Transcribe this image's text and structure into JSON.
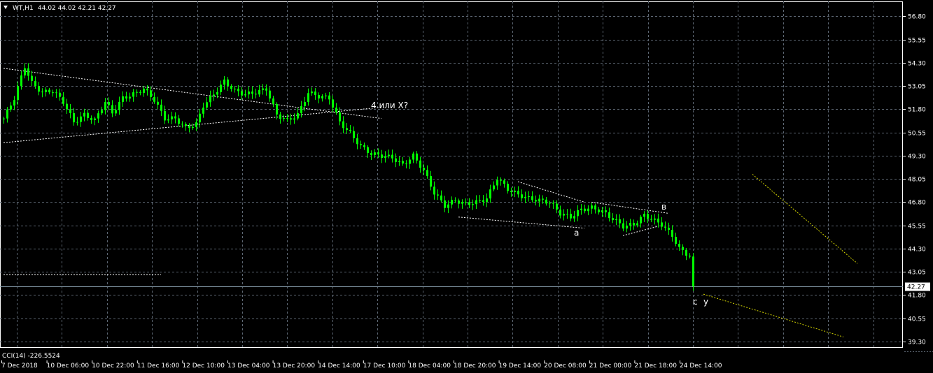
{
  "header": {
    "symbol": "WT,H1",
    "ohlc": "44.02 44.02 42.21 42.27",
    "arrow_icon": "triangle-down-icon"
  },
  "indicator": {
    "label": "CCI(14) -226.5524"
  },
  "colors": {
    "background": "#000000",
    "grid": "#5c6672",
    "candle": "#00ff00",
    "trendline": "#ffffff",
    "forecast": "#d6d600",
    "price_line": "#8aa0b0"
  },
  "chart_data": {
    "type": "candlestick",
    "ylim": [
      39.0,
      57.6
    ],
    "y_ticks": [
      "56.80",
      "55.55",
      "54.30",
      "53.05",
      "51.80",
      "50.55",
      "49.30",
      "48.05",
      "46.80",
      "45.55",
      "44.30",
      "43.05",
      "41.80",
      "40.55",
      "39.30"
    ],
    "y_tick_values": [
      56.8,
      55.55,
      54.3,
      53.05,
      51.8,
      50.55,
      49.3,
      48.05,
      46.8,
      45.55,
      44.3,
      43.05,
      41.8,
      40.55,
      39.3
    ],
    "x_ticks": [
      "7 Dec 2018",
      "10 Dec 06:00",
      "10 Dec 22:00",
      "11 Dec 16:00",
      "12 Dec 10:00",
      "13 Dec 04:00",
      "13 Dec 20:00",
      "14 Dec 14:00",
      "17 Dec 10:00",
      "18 Dec 04:00",
      "18 Dec 20:00",
      "19 Dec 14:00",
      "20 Dec 08:00",
      "21 Dec 00:00",
      "21 Dec 18:00",
      "24 Dec 14:00"
    ],
    "current_price": "42.27",
    "current_price_value": 42.27,
    "close_path": [
      [
        0,
        51.3
      ],
      [
        3,
        52.4
      ],
      [
        6,
        54.1
      ],
      [
        8,
        53.2
      ],
      [
        11,
        52.7
      ],
      [
        14,
        52.8
      ],
      [
        17,
        52.2
      ],
      [
        20,
        51.1
      ],
      [
        23,
        51.5
      ],
      [
        26,
        51.2
      ],
      [
        29,
        52.2
      ],
      [
        31,
        51.6
      ],
      [
        34,
        52.4
      ],
      [
        37,
        52.6
      ],
      [
        40,
        52.9
      ],
      [
        43,
        52.3
      ],
      [
        46,
        51.3
      ],
      [
        49,
        51.3
      ],
      [
        52,
        50.8
      ],
      [
        55,
        51.0
      ],
      [
        57,
        52.0
      ],
      [
        60,
        52.6
      ],
      [
        63,
        53.3
      ],
      [
        66,
        52.8
      ],
      [
        69,
        52.6
      ],
      [
        72,
        52.7
      ],
      [
        75,
        52.9
      ],
      [
        78,
        51.5
      ],
      [
        81,
        51.2
      ],
      [
        84,
        51.5
      ],
      [
        87,
        52.7
      ],
      [
        90,
        52.5
      ],
      [
        93,
        52.4
      ],
      [
        96,
        51.1
      ],
      [
        99,
        50.5
      ],
      [
        102,
        49.8
      ],
      [
        105,
        49.4
      ],
      [
        108,
        49.3
      ],
      [
        111,
        49.2
      ],
      [
        114,
        48.8
      ],
      [
        117,
        49.3
      ],
      [
        120,
        48.5
      ],
      [
        123,
        47.3
      ],
      [
        126,
        46.6
      ],
      [
        129,
        46.9
      ],
      [
        132,
        46.7
      ],
      [
        135,
        46.8
      ],
      [
        138,
        47.0
      ],
      [
        141,
        48.1
      ],
      [
        144,
        47.5
      ],
      [
        147,
        47.2
      ],
      [
        150,
        47.0
      ],
      [
        153,
        46.9
      ],
      [
        156,
        46.8
      ],
      [
        159,
        46.2
      ],
      [
        162,
        46.0
      ],
      [
        165,
        46.4
      ],
      [
        168,
        46.5
      ],
      [
        171,
        46.3
      ],
      [
        174,
        45.9
      ],
      [
        177,
        45.5
      ],
      [
        180,
        45.6
      ],
      [
        183,
        46.1
      ],
      [
        185,
        45.9
      ],
      [
        188,
        45.6
      ],
      [
        191,
        45.0
      ],
      [
        193,
        44.3
      ],
      [
        196,
        43.9
      ],
      [
        197,
        42.27
      ]
    ],
    "trendlines": [
      {
        "kind": "upper",
        "from": [
          0,
          54.0
        ],
        "to": [
          108,
          51.3
        ]
      },
      {
        "kind": "lower",
        "from": [
          0,
          50.0
        ],
        "to": [
          108,
          51.9
        ]
      },
      {
        "kind": "upper",
        "from": [
          147,
          47.9
        ],
        "to": [
          166,
          46.8
        ]
      },
      {
        "kind": "lower",
        "from": [
          130,
          46.0
        ],
        "to": [
          166,
          45.4
        ]
      },
      {
        "kind": "upper",
        "from": [
          168,
          46.8
        ],
        "to": [
          190,
          46.2
        ]
      },
      {
        "kind": "lower",
        "from": [
          177,
          45.0
        ],
        "to": [
          187,
          45.5
        ]
      },
      {
        "kind": "horizontal",
        "from": [
          0,
          42.9
        ],
        "to": [
          45,
          42.9
        ]
      }
    ],
    "forecast_lines": [
      {
        "from": [
          200,
          41.85
        ],
        "to": [
          240,
          39.55
        ]
      },
      {
        "from": [
          214,
          48.3
        ],
        "to": [
          244,
          43.5
        ]
      }
    ],
    "labels": [
      {
        "text": "4 или X?",
        "at": [
          105,
          51.85
        ]
      },
      {
        "text": "а",
        "at": [
          163,
          45.0
        ]
      },
      {
        "text": "в",
        "at": [
          188,
          46.4
        ]
      },
      {
        "text": "с",
        "at": [
          197,
          41.3
        ]
      },
      {
        "text": "y",
        "at": [
          200,
          41.3
        ]
      }
    ]
  }
}
